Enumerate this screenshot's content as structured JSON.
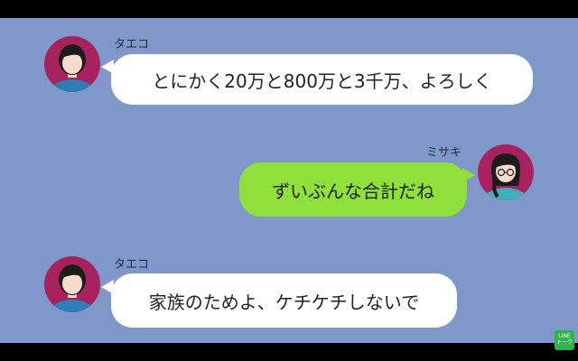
{
  "messages": [
    {
      "sender": "タエコ",
      "side": "left",
      "text": "とにかく20万と800万と3千万、よろしく"
    },
    {
      "sender": "ミサキ",
      "side": "right",
      "text": "ずいぶんな合計だね"
    },
    {
      "sender": "タエコ",
      "side": "left",
      "text": "家族のためよ、ケチケチしないで"
    }
  ],
  "badge": {
    "line1": "LINE",
    "line2": "トーク"
  },
  "colors": {
    "background": "#7f97c9",
    "left_bubble": "#ffffff",
    "right_bubble": "#8fe03b",
    "avatar_bg": "#a8235e",
    "letterbox": "#000000"
  }
}
